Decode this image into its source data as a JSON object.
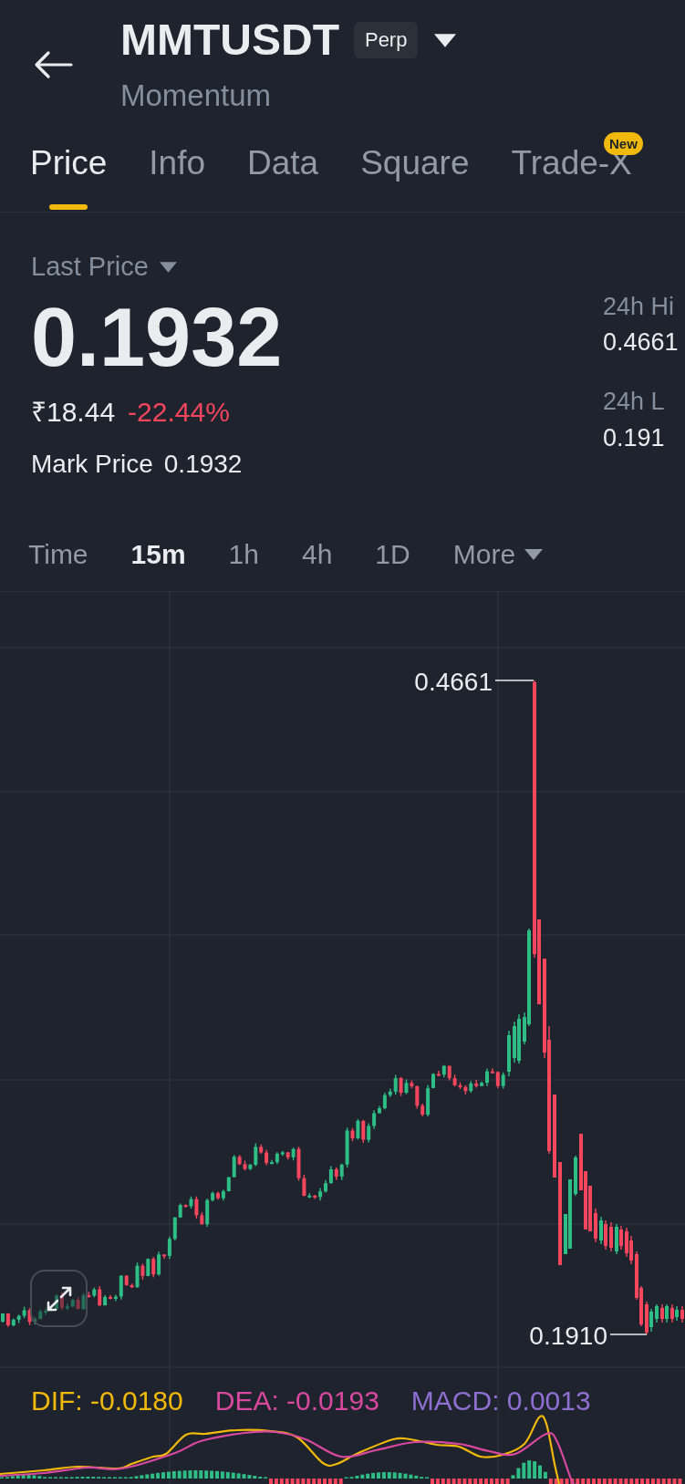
{
  "header": {
    "title": "MMTUSDT",
    "badge": "Perp",
    "subtitle": "Momentum"
  },
  "tabs": [
    {
      "label": "Price",
      "selected": true
    },
    {
      "label": "Info",
      "selected": false
    },
    {
      "label": "Data",
      "selected": false
    },
    {
      "label": "Square",
      "selected": false
    },
    {
      "label": "Trade-X",
      "selected": false,
      "badge": "New"
    }
  ],
  "price": {
    "selector": "Last Price",
    "last": "0.1932",
    "fiat": "₹18.44",
    "change": "-22.44%",
    "mark_label": "Mark Price",
    "mark_value": "0.1932"
  },
  "stats": [
    {
      "label": "24h Hi",
      "value": "0.4661"
    },
    {
      "label": "24h L",
      "value": "0.191"
    }
  ],
  "intervals": [
    {
      "label": "Time",
      "selected": false,
      "kind": "option"
    },
    {
      "label": "15m",
      "selected": true,
      "kind": "option"
    },
    {
      "label": "1h",
      "selected": false,
      "kind": "option"
    },
    {
      "label": "4h",
      "selected": false,
      "kind": "option"
    },
    {
      "label": "1D",
      "selected": false,
      "kind": "option"
    },
    {
      "label": "More",
      "selected": false,
      "kind": "dropdown"
    }
  ],
  "chart": {
    "high_label": "0.4661",
    "low_label": "0.1910"
  },
  "macd": {
    "legend": [
      {
        "text": "DIF: -0.0180",
        "color": "#f0b90b"
      },
      {
        "text": "DEA: -0.0193",
        "color": "#d9489f"
      },
      {
        "text": "MACD: 0.0013",
        "color": "#8f6fd1"
      }
    ]
  }
}
